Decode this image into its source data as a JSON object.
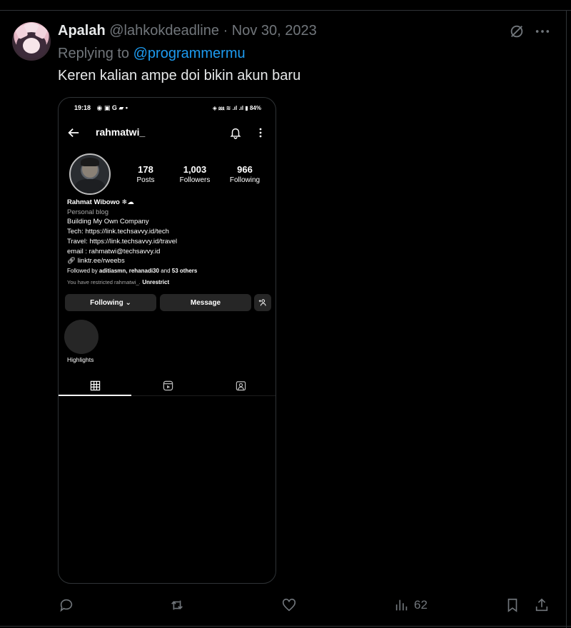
{
  "tweet": {
    "display_name": "Apalah",
    "handle": "@lahkokdeadline",
    "separator": "·",
    "date": "Nov 30, 2023",
    "replying_to_label": "Replying to",
    "replying_to_handle": "@programmermu",
    "text": "Keren kalian ampe doi bikin akun baru",
    "icons": {
      "grok": "grok-icon",
      "more": "more-horizontal-icon"
    }
  },
  "screenshot": {
    "status_time": "19:18",
    "status_battery": "84%",
    "username": "rahmatwi_",
    "stats": [
      {
        "value": "178",
        "label": "Posts"
      },
      {
        "value": "1,003",
        "label": "Followers"
      },
      {
        "value": "966",
        "label": "Following"
      }
    ],
    "bio": {
      "name": "Rahmat Wibowo ❄☁",
      "category": "Personal blog",
      "line1": "Building My Own Company",
      "line2": "Tech: https://link.techsavvy.id/tech",
      "line3": "Travel: https://link.techsavvy.id/travel",
      "line4": "email : rahmatwi@techsavvy.id",
      "link": "linktr.ee/rweebs",
      "followed_by_prefix": "Followed by",
      "followed_by_names": "aditiasmn, rehanadi30",
      "followed_by_and": "and",
      "followed_by_others": "53 others",
      "restricted_text": "You have restricted rahmatwi_.",
      "unrestrict": "Unrestrict"
    },
    "buttons": {
      "following": "Following ⌄",
      "message": "Message"
    },
    "highlights_label": "Highlights"
  },
  "actions": {
    "views": "62"
  }
}
